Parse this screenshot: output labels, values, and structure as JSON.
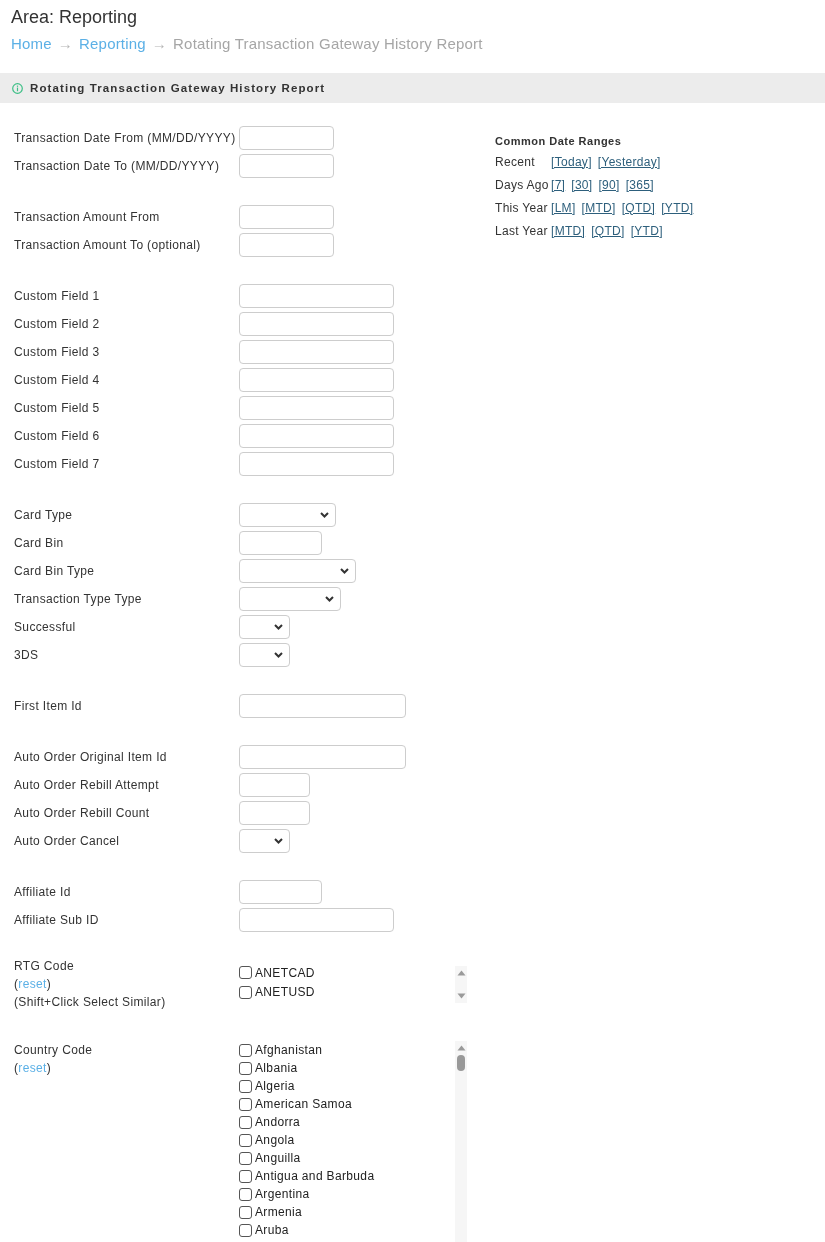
{
  "header": {
    "area_title": "Area: Reporting"
  },
  "breadcrumb": [
    {
      "label": "Home",
      "current": false
    },
    {
      "separator": "→",
      "label": "Reporting",
      "current": false
    },
    {
      "separator": "→",
      "label": "Rotating Transaction Gateway History Report",
      "current": true
    }
  ],
  "section": {
    "title": "Rotating Transaction Gateway History Report"
  },
  "form": {
    "groups": [
      {
        "fields": [
          {
            "label": "Transaction Date From (MM/DD/YYYY)",
            "kind": "input"
          },
          {
            "label": "Transaction Date To (MM/DD/YYYY)",
            "kind": "input"
          }
        ]
      },
      {
        "fields": [
          {
            "label": "Transaction Amount From",
            "kind": "input"
          },
          {
            "label": "Transaction Amount To (optional)",
            "kind": "input"
          }
        ]
      },
      {
        "fields": [
          {
            "label": "Custom Field 1",
            "kind": "input"
          },
          {
            "label": "Custom Field 2",
            "kind": "input"
          },
          {
            "label": "Custom Field 3",
            "kind": "input"
          },
          {
            "label": "Custom Field 4",
            "kind": "input"
          },
          {
            "label": "Custom Field 5",
            "kind": "input"
          },
          {
            "label": "Custom Field 6",
            "kind": "input"
          },
          {
            "label": "Custom Field 7",
            "kind": "input"
          }
        ]
      },
      {
        "fields": [
          {
            "label": "Card Type",
            "kind": "select"
          },
          {
            "label": "Card Bin",
            "kind": "input"
          },
          {
            "label": "Card Bin Type",
            "kind": "select"
          },
          {
            "label": "Transaction Type Type",
            "kind": "select"
          },
          {
            "label": "Successful",
            "kind": "select"
          },
          {
            "label": "3DS",
            "kind": "select"
          }
        ]
      },
      {
        "fields": [
          {
            "label": "First Item Id",
            "kind": "input"
          }
        ]
      },
      {
        "fields": [
          {
            "label": "Auto Order Original Item Id",
            "kind": "input"
          },
          {
            "label": "Auto Order Rebill Attempt",
            "kind": "input"
          },
          {
            "label": "Auto Order Rebill Count",
            "kind": "input"
          },
          {
            "label": "Auto Order Cancel",
            "kind": "select"
          }
        ]
      },
      {
        "fields": [
          {
            "label": "Affiliate Id",
            "kind": "input"
          },
          {
            "label": "Affiliate Sub ID",
            "kind": "input"
          }
        ]
      }
    ],
    "checklists": [
      {
        "label": "RTG Code",
        "reset": {
          "open": "(",
          "link": "reset",
          "close": ")"
        },
        "hint": "(Shift+Click Select Similar)",
        "options": [
          {
            "label": "ANETCAD",
            "checked": false
          },
          {
            "label": "ANETUSD",
            "checked": false
          }
        ]
      },
      {
        "label": "Country Code",
        "reset": {
          "open": "(",
          "link": "reset",
          "close": ")"
        },
        "options": [
          {
            "label": "Afghanistan",
            "checked": false
          },
          {
            "label": "Albania",
            "checked": false
          },
          {
            "label": "Algeria",
            "checked": false
          },
          {
            "label": "American Samoa",
            "checked": false
          },
          {
            "label": "Andorra",
            "checked": false
          },
          {
            "label": "Angola",
            "checked": false
          },
          {
            "label": "Anguilla",
            "checked": false
          },
          {
            "label": "Antigua and Barbuda",
            "checked": false
          },
          {
            "label": "Argentina",
            "checked": false
          },
          {
            "label": "Armenia",
            "checked": false
          },
          {
            "label": "Aruba",
            "checked": false
          }
        ]
      }
    ]
  },
  "common_date_ranges": {
    "title": "Common Date Ranges",
    "rows": [
      {
        "label": "Recent",
        "links": [
          "[Today]",
          "[Yesterday]"
        ]
      },
      {
        "label": "Days Ago",
        "links": [
          "[7]",
          "[30]",
          "[90]",
          "[365]"
        ]
      },
      {
        "label": "This Year",
        "links": [
          "[LM]",
          "[MTD]",
          "[QTD]",
          "[YTD]"
        ]
      },
      {
        "label": "Last Year",
        "links": [
          "[MTD]",
          "[QTD]",
          "[YTD]"
        ]
      }
    ]
  }
}
